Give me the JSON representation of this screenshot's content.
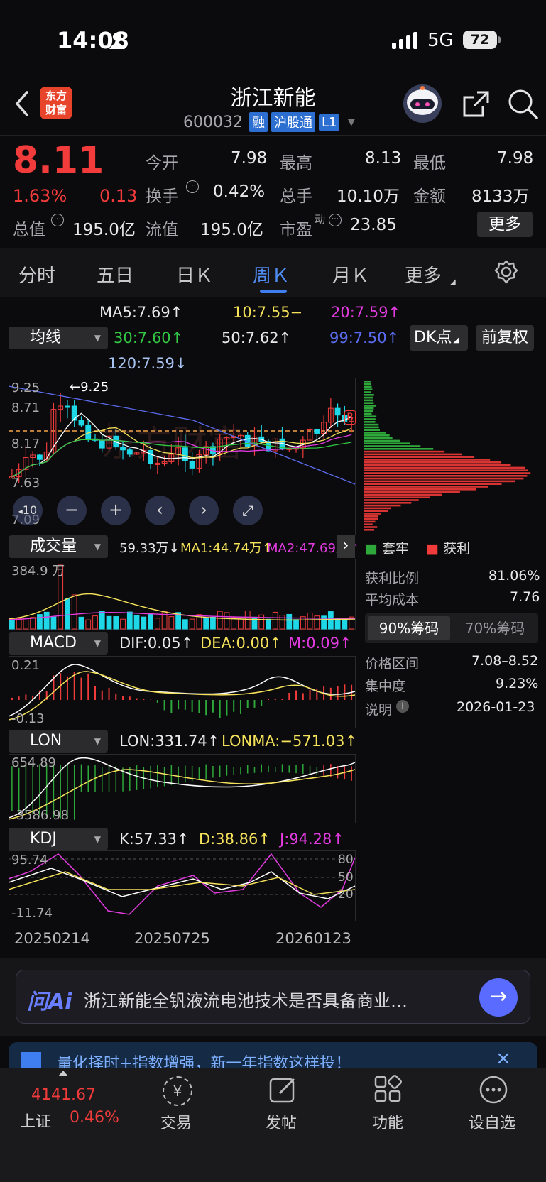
{
  "status": {
    "time": "14:08",
    "network": "5G",
    "battery": "72"
  },
  "header": {
    "logo_line1": "东方",
    "logo_line2": "财富",
    "name": "浙江新能",
    "code": "600032",
    "tags": [
      "融",
      "沪股通",
      "L1"
    ]
  },
  "quote": {
    "price": "8.11",
    "pct": "1.63%",
    "change": "0.13",
    "open_label": "今开",
    "open": "7.98",
    "high_label": "最高",
    "high": "8.13",
    "low_label": "最低",
    "low": "7.98",
    "turnover_label": "换手",
    "turnover": "0.42%",
    "volume_label": "总手",
    "volume": "10.10万",
    "amount_label": "金额",
    "amount": "8133万",
    "mcap_label": "总值",
    "mcap": "195.0亿",
    "float_label": "流值",
    "float": "195.0亿",
    "pe_label": "市盈",
    "pe_sup": "动",
    "pe": "23.85",
    "more": "更多"
  },
  "tabs": [
    "分时",
    "五日",
    "日Ｋ",
    "周Ｋ",
    "月Ｋ",
    "更多"
  ],
  "ma": {
    "selector": "均线",
    "ma5": "MA5:7.69↑",
    "ma10": "10:7.55−",
    "ma20": "20:7.59↑",
    "ma30": "30:7.60↑",
    "ma50": "50:7.62↑",
    "ma99": "99:7.50↑",
    "ma120": "120:7.59↓",
    "dk": "DK点",
    "fq": "前复权"
  },
  "kline": {
    "ylabels": [
      "9.25",
      "8.71",
      "8.17",
      "7.63",
      "7.09"
    ],
    "max_marker": "←9.25",
    "watermark": "东方财富",
    "b_marker": "B",
    "zoom": "10"
  },
  "volume": {
    "selector": "成交量",
    "vol": "59.33万↓",
    "ma1": "MA1:44.74万↑",
    "ma2": "MA2:47.69万↑",
    "ylabel": "384.9 万"
  },
  "macd": {
    "selector": "MACD",
    "dif": "DIF:0.05↑",
    "dea": "DEA:0.00↑",
    "m": "M:0.09↑",
    "ytop": "0.21",
    "ybot": "-0.13"
  },
  "lon": {
    "selector": "LON",
    "lon": "LON:331.74↑",
    "lonma": "LONMA:−571.03↑",
    "ytop": "654.89",
    "ybot": "-3586.98"
  },
  "kdj": {
    "selector": "KDJ",
    "k": "K:57.33↑",
    "d": "D:38.86↑",
    "j": "J:94.28↑",
    "ytop": "95.74",
    "ybot": "-11.74",
    "r80": "80",
    "r50": "50",
    "r20": "20"
  },
  "dates": [
    "20250214",
    "20250725",
    "20260123"
  ],
  "chips": {
    "legend_loss": "套牢",
    "legend_profit": "获利",
    "profit_ratio_label": "获利比例",
    "profit_ratio": "81.06%",
    "avg_cost_label": "平均成本",
    "avg_cost": "7.76",
    "tab90": "90%筹码",
    "tab70": "70%筹码",
    "range_label": "价格区间",
    "range": "7.08–8.52",
    "conc_label": "集中度",
    "conc": "9.23%",
    "note_label": "说明",
    "note_date": "2026-01-23"
  },
  "ai": {
    "logo": "问Ai",
    "text": "浙江新能全钒液流电池技术是否具备商业…"
  },
  "banner": {
    "text": "量化择时+指数增强，新一年指数这样投！"
  },
  "bottom": {
    "index_value": "4141.67",
    "index_name": "上证",
    "index_pct": "0.46%",
    "trade": "交易",
    "post": "发帖",
    "func": "功能",
    "watch": "设自选"
  },
  "colors": {
    "up": "#f23b3b",
    "down": "#1ed8e8",
    "accent": "#3e7ef0",
    "yellow": "#f5e25a",
    "magenta": "#e23be0",
    "green": "#2ea83a"
  }
}
